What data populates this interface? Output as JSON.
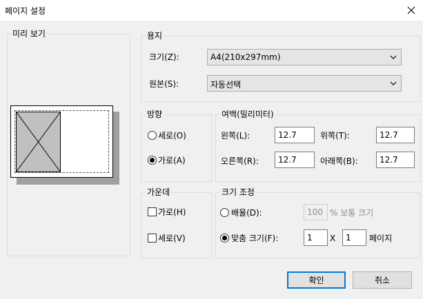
{
  "window": {
    "title": "페이지 설정"
  },
  "preview": {
    "title": "미리 보기"
  },
  "paper": {
    "title": "용지",
    "size_label": "크기(Z):",
    "size_value": "A4(210x297mm)",
    "source_label": "원본(S):",
    "source_value": "자동선택"
  },
  "orientation": {
    "title": "방향",
    "portrait_label": "세로(O)",
    "landscape_label": "가로(A)",
    "selected": "landscape"
  },
  "margins": {
    "title": "여백(밀리미터)",
    "left_label": "왼쪽(L):",
    "left_value": "12.7",
    "top_label": "위쪽(T):",
    "top_value": "12.7",
    "right_label": "오른쪽(R):",
    "right_value": "12.7",
    "bottom_label": "아래쪽(B):",
    "bottom_value": "12.7"
  },
  "center": {
    "title": "가운데",
    "horizontal_label": "가로(H)",
    "vertical_label": "세로(V)"
  },
  "scaling": {
    "title": "크기 조정",
    "adjust_label": "배율(D):",
    "adjust_value": "100",
    "adjust_suffix": "% 보통 크기",
    "fit_label": "맞춤 크기(F):",
    "fit_wide": "1",
    "fit_x": "X",
    "fit_tall": "1",
    "fit_suffix": "페이지"
  },
  "buttons": {
    "ok": "확인",
    "cancel": "취소"
  },
  "colors": {
    "accent": "#0078d7",
    "page_bg": "#f0f0f0",
    "preview_fill": "#c0c0c0",
    "shadow": "#a0a0a0"
  }
}
